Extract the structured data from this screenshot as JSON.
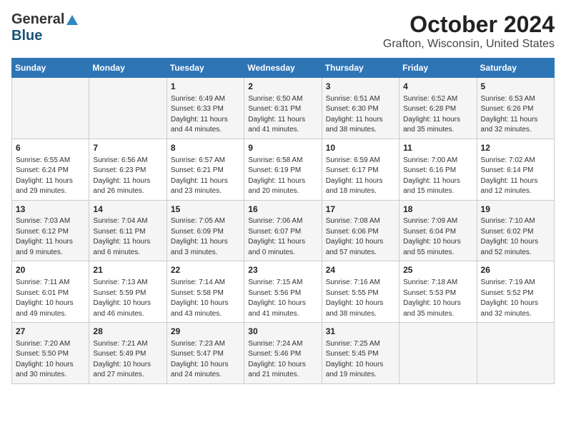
{
  "logo": {
    "line1": "General",
    "line2": "Blue"
  },
  "title": "October 2024",
  "subtitle": "Grafton, Wisconsin, United States",
  "weekdays": [
    "Sunday",
    "Monday",
    "Tuesday",
    "Wednesday",
    "Thursday",
    "Friday",
    "Saturday"
  ],
  "weeks": [
    [
      {
        "day": "",
        "info": ""
      },
      {
        "day": "",
        "info": ""
      },
      {
        "day": "1",
        "info": "Sunrise: 6:49 AM\nSunset: 6:33 PM\nDaylight: 11 hours and 44 minutes."
      },
      {
        "day": "2",
        "info": "Sunrise: 6:50 AM\nSunset: 6:31 PM\nDaylight: 11 hours and 41 minutes."
      },
      {
        "day": "3",
        "info": "Sunrise: 6:51 AM\nSunset: 6:30 PM\nDaylight: 11 hours and 38 minutes."
      },
      {
        "day": "4",
        "info": "Sunrise: 6:52 AM\nSunset: 6:28 PM\nDaylight: 11 hours and 35 minutes."
      },
      {
        "day": "5",
        "info": "Sunrise: 6:53 AM\nSunset: 6:26 PM\nDaylight: 11 hours and 32 minutes."
      }
    ],
    [
      {
        "day": "6",
        "info": "Sunrise: 6:55 AM\nSunset: 6:24 PM\nDaylight: 11 hours and 29 minutes."
      },
      {
        "day": "7",
        "info": "Sunrise: 6:56 AM\nSunset: 6:23 PM\nDaylight: 11 hours and 26 minutes."
      },
      {
        "day": "8",
        "info": "Sunrise: 6:57 AM\nSunset: 6:21 PM\nDaylight: 11 hours and 23 minutes."
      },
      {
        "day": "9",
        "info": "Sunrise: 6:58 AM\nSunset: 6:19 PM\nDaylight: 11 hours and 20 minutes."
      },
      {
        "day": "10",
        "info": "Sunrise: 6:59 AM\nSunset: 6:17 PM\nDaylight: 11 hours and 18 minutes."
      },
      {
        "day": "11",
        "info": "Sunrise: 7:00 AM\nSunset: 6:16 PM\nDaylight: 11 hours and 15 minutes."
      },
      {
        "day": "12",
        "info": "Sunrise: 7:02 AM\nSunset: 6:14 PM\nDaylight: 11 hours and 12 minutes."
      }
    ],
    [
      {
        "day": "13",
        "info": "Sunrise: 7:03 AM\nSunset: 6:12 PM\nDaylight: 11 hours and 9 minutes."
      },
      {
        "day": "14",
        "info": "Sunrise: 7:04 AM\nSunset: 6:11 PM\nDaylight: 11 hours and 6 minutes."
      },
      {
        "day": "15",
        "info": "Sunrise: 7:05 AM\nSunset: 6:09 PM\nDaylight: 11 hours and 3 minutes."
      },
      {
        "day": "16",
        "info": "Sunrise: 7:06 AM\nSunset: 6:07 PM\nDaylight: 11 hours and 0 minutes."
      },
      {
        "day": "17",
        "info": "Sunrise: 7:08 AM\nSunset: 6:06 PM\nDaylight: 10 hours and 57 minutes."
      },
      {
        "day": "18",
        "info": "Sunrise: 7:09 AM\nSunset: 6:04 PM\nDaylight: 10 hours and 55 minutes."
      },
      {
        "day": "19",
        "info": "Sunrise: 7:10 AM\nSunset: 6:02 PM\nDaylight: 10 hours and 52 minutes."
      }
    ],
    [
      {
        "day": "20",
        "info": "Sunrise: 7:11 AM\nSunset: 6:01 PM\nDaylight: 10 hours and 49 minutes."
      },
      {
        "day": "21",
        "info": "Sunrise: 7:13 AM\nSunset: 5:59 PM\nDaylight: 10 hours and 46 minutes."
      },
      {
        "day": "22",
        "info": "Sunrise: 7:14 AM\nSunset: 5:58 PM\nDaylight: 10 hours and 43 minutes."
      },
      {
        "day": "23",
        "info": "Sunrise: 7:15 AM\nSunset: 5:56 PM\nDaylight: 10 hours and 41 minutes."
      },
      {
        "day": "24",
        "info": "Sunrise: 7:16 AM\nSunset: 5:55 PM\nDaylight: 10 hours and 38 minutes."
      },
      {
        "day": "25",
        "info": "Sunrise: 7:18 AM\nSunset: 5:53 PM\nDaylight: 10 hours and 35 minutes."
      },
      {
        "day": "26",
        "info": "Sunrise: 7:19 AM\nSunset: 5:52 PM\nDaylight: 10 hours and 32 minutes."
      }
    ],
    [
      {
        "day": "27",
        "info": "Sunrise: 7:20 AM\nSunset: 5:50 PM\nDaylight: 10 hours and 30 minutes."
      },
      {
        "day": "28",
        "info": "Sunrise: 7:21 AM\nSunset: 5:49 PM\nDaylight: 10 hours and 27 minutes."
      },
      {
        "day": "29",
        "info": "Sunrise: 7:23 AM\nSunset: 5:47 PM\nDaylight: 10 hours and 24 minutes."
      },
      {
        "day": "30",
        "info": "Sunrise: 7:24 AM\nSunset: 5:46 PM\nDaylight: 10 hours and 21 minutes."
      },
      {
        "day": "31",
        "info": "Sunrise: 7:25 AM\nSunset: 5:45 PM\nDaylight: 10 hours and 19 minutes."
      },
      {
        "day": "",
        "info": ""
      },
      {
        "day": "",
        "info": ""
      }
    ]
  ]
}
